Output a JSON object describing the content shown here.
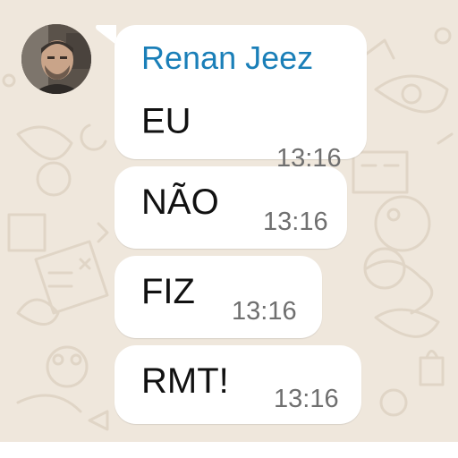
{
  "chat": {
    "background_color": "#efe7dc",
    "sender": {
      "name": "Renan Jeez",
      "name_color": "#1a7fb8"
    },
    "messages": [
      {
        "text": "EU",
        "time": "13:16"
      },
      {
        "text": "NÃO",
        "time": "13:16"
      },
      {
        "text": "FIZ",
        "time": "13:16"
      },
      {
        "text": "RMT!",
        "time": "13:16"
      }
    ]
  }
}
